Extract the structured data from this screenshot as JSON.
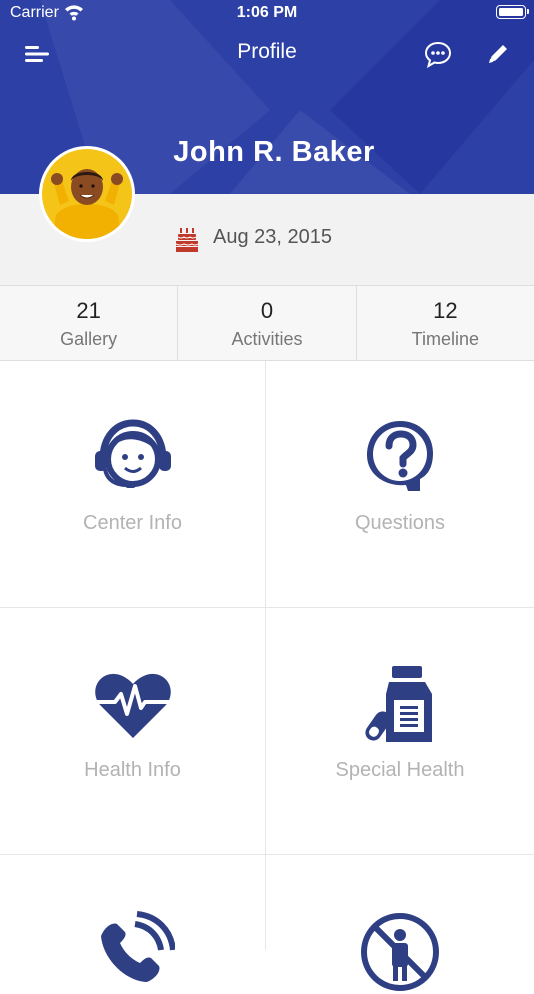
{
  "status_bar": {
    "carrier": "Carrier",
    "time": "1:06 PM"
  },
  "nav": {
    "title": "Profile"
  },
  "profile": {
    "name": "John R. Baker",
    "birthdate": "Aug 23, 2015"
  },
  "stats": [
    {
      "value": "21",
      "label": "Gallery"
    },
    {
      "value": "0",
      "label": "Activities"
    },
    {
      "value": "12",
      "label": "Timeline"
    }
  ],
  "tiles": [
    {
      "label": "Center Info",
      "icon": "headset-agent-icon"
    },
    {
      "label": "Questions",
      "icon": "question-head-icon"
    },
    {
      "label": "Health Info",
      "icon": "heart-pulse-icon"
    },
    {
      "label": "Special Health",
      "icon": "medicine-bottle-icon"
    },
    {
      "label": "",
      "icon": "phone-icon"
    },
    {
      "label": "",
      "icon": "no-entry-person-icon"
    }
  ],
  "colors": {
    "header": "#2d40a6",
    "icon_blue": "#2f3f83",
    "cake_red": "#c0392b",
    "tile_label": "#b3b3b3"
  }
}
